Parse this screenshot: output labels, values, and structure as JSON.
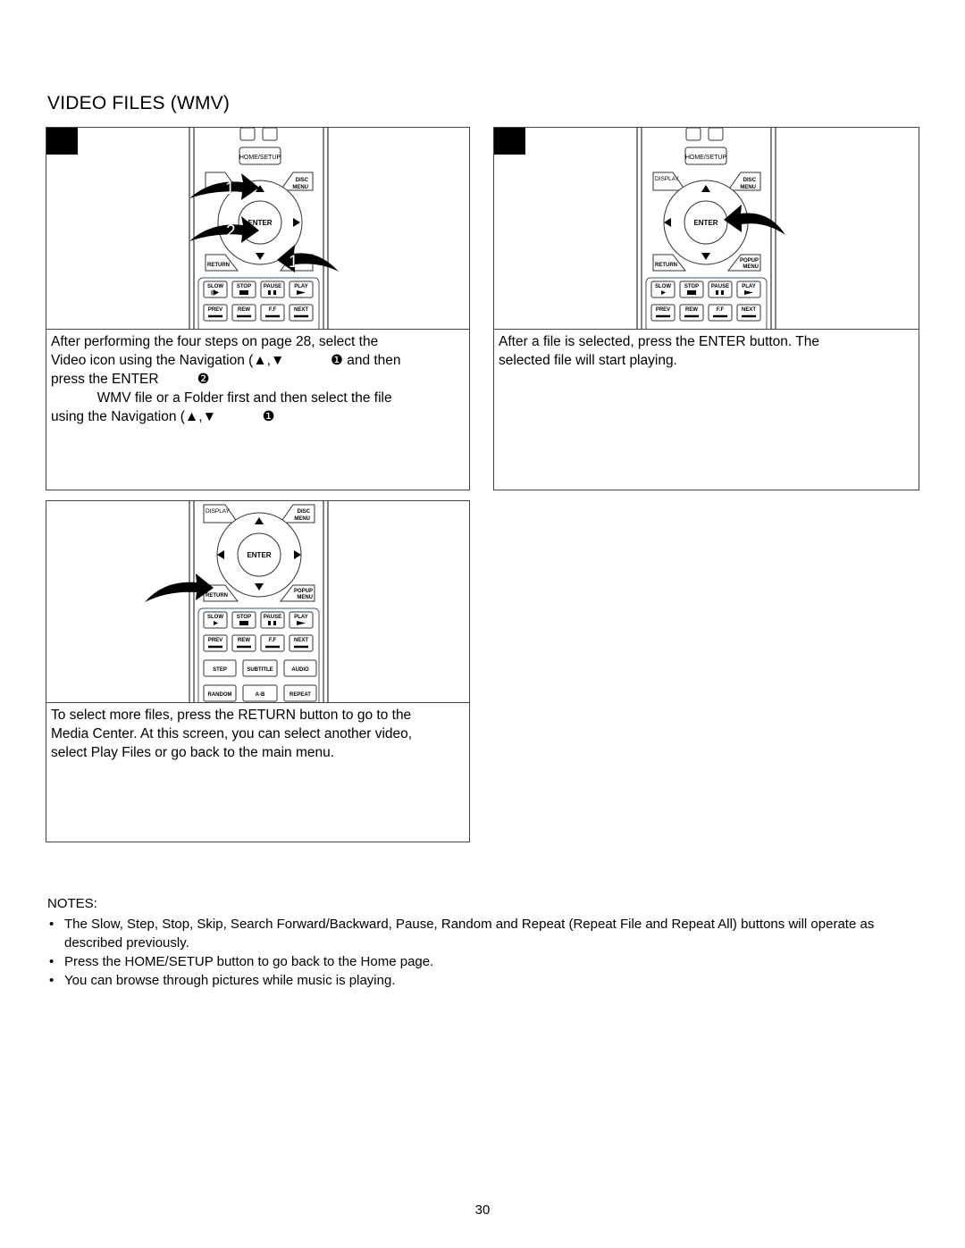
{
  "page": {
    "title": "VIDEO FILES (WMV)",
    "page_number": "30"
  },
  "remote_labels": {
    "home_setup": "HOME/SETUP",
    "display": "DISPLAY",
    "disc": "DISC",
    "menu": "MENU",
    "enter": "ENTER",
    "return": "RETURN",
    "popup": "POPUP",
    "slow": "SLOW",
    "stop": "STOP",
    "pause": "PAUSE",
    "play": "PLAY",
    "prev": "PREV",
    "rew": "REW",
    "ff": "F.F",
    "next": "NEXT",
    "step": "STEP",
    "subtitle": "SUBTITLE",
    "audio": "AUDIO",
    "random": "RANDOM",
    "ab": "A-B",
    "repeat": "REPEAT"
  },
  "panels": [
    {
      "id": "step-1",
      "callouts": [
        "1",
        "2",
        "1"
      ],
      "lines": [
        "After performing the four steps on page 28, select the",
        "Video icon using the Navigation (▲,▼            ❶ and then",
        "press the ENTER          ❷",
        "            WMV file or a Folder first and then select the file",
        "using the Navigation (▲,▼            ❶"
      ]
    },
    {
      "id": "step-2",
      "lines": [
        "After a file is selected, press the ENTER button. The",
        "selected file will start playing."
      ]
    },
    {
      "id": "step-3",
      "lines": [
        "To select more files, press the RETURN button to go to the",
        "Media Center. At this screen, you can select another video,",
        "select Play Files or go back to the main menu."
      ]
    }
  ],
  "notes": {
    "heading": "NOTES:",
    "bullet": "•",
    "items": [
      "The Slow, Step, Stop, Skip, Search Forward/Backward, Pause, Random and Repeat (Repeat File and Repeat All) buttons will operate as described previously.",
      "Press the HOME/SETUP button to go back to the Home page.",
      "You can browse through pictures while music is playing."
    ]
  }
}
